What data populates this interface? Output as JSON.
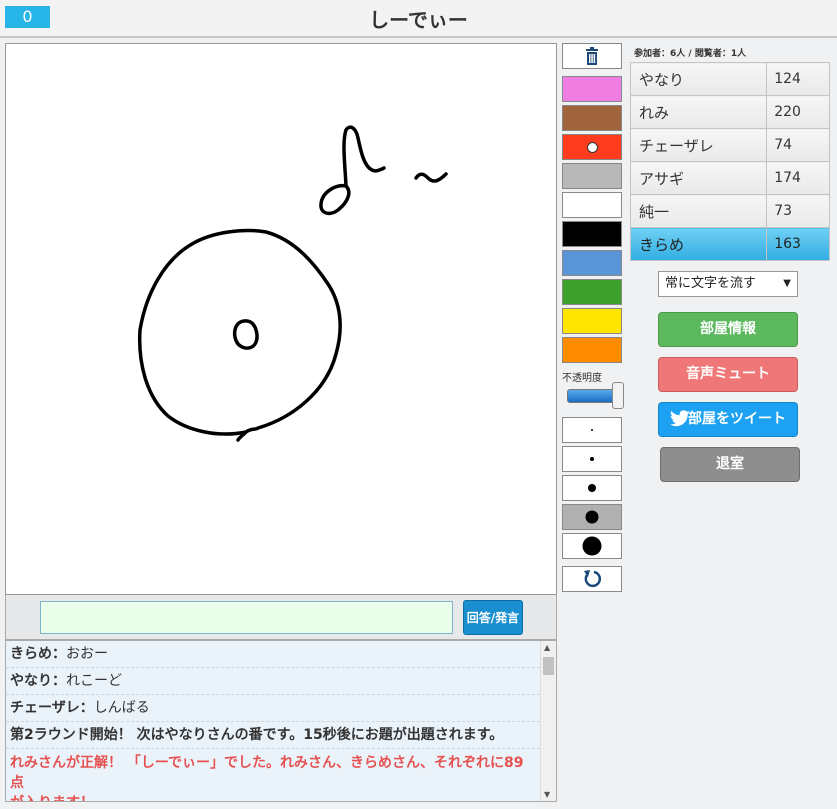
{
  "header": {
    "score": "0",
    "title": "しーでぃー"
  },
  "answer": {
    "input_value": "",
    "button_label": "回答/発言"
  },
  "chat": {
    "messages": [
      {
        "user": "きらめ",
        "sep": "：",
        "text": "おおー"
      },
      {
        "user": "やなり",
        "sep": "：",
        "text": "れこーど"
      },
      {
        "user": "チェーザレ",
        "sep": "：",
        "text": "しんばる"
      }
    ],
    "system_message": "第2ラウンド開始！ 次はやなりさんの番です。15秒後にお題が出題されます。",
    "correct_message_line1": "れみさんが正解！ 「しーでぃー」でした。れみさん、きらめさん、それぞれに89点",
    "correct_message_line2": "が入ります！"
  },
  "tools": {
    "trash_icon": "trash-icon",
    "colors": [
      "#f07ee0",
      "#a0643c",
      "#ff3b1e",
      "#b8b8b8",
      "#ffffff",
      "#000000",
      "#5a95d8",
      "#3da02d",
      "#ffe600",
      "#ff8c00"
    ],
    "selected_color_index": 2,
    "opacity_label": "不透明度",
    "opacity_level": 1.0,
    "pen_sizes": [
      2,
      4,
      8,
      13,
      19
    ],
    "selected_pen_index": 3,
    "undo_icon": "undo-icon"
  },
  "room": {
    "participants_text": "参加者：6人 / 閲覧者：1人",
    "players": [
      {
        "name": "やなり",
        "score": "124"
      },
      {
        "name": "れみ",
        "score": "220"
      },
      {
        "name": "チェーザレ",
        "score": "74"
      },
      {
        "name": "アサギ",
        "score": "174"
      },
      {
        "name": "純一",
        "score": "73"
      },
      {
        "name": "きらめ",
        "score": "163"
      }
    ],
    "current_player_index": 5,
    "flow_select_value": "常に文字を流す",
    "room_info_label": "部屋情報",
    "mute_label": "音声ミュート",
    "tweet_label": "部屋をツイート",
    "exit_label": "退室"
  }
}
